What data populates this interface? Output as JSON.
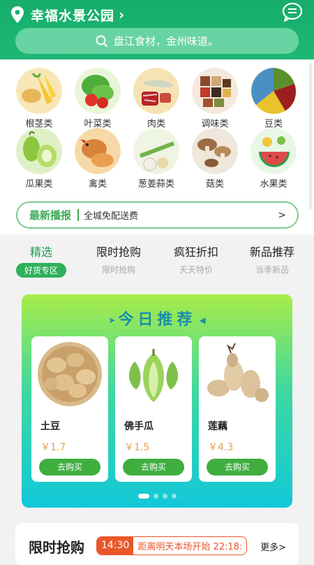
{
  "header": {
    "location": "幸福水景公园",
    "search_placeholder": "盘江食材，金州味道。"
  },
  "categories": [
    {
      "label": "根茎类",
      "icon": "root-vegetables-icon",
      "color": "#f4c24c"
    },
    {
      "label": "叶菜类",
      "icon": "leafy-greens-icon",
      "color": "#4fae3a"
    },
    {
      "label": "肉类",
      "icon": "meat-icon",
      "color": "#c8453a"
    },
    {
      "label": "调味类",
      "icon": "seasoning-icon",
      "color": "#a0522d"
    },
    {
      "label": "豆类",
      "icon": "beans-icon",
      "color": "#7a9a3a"
    },
    {
      "label": "瓜果类",
      "icon": "gourd-icon",
      "color": "#8cc63e"
    },
    {
      "label": "禽类",
      "icon": "poultry-icon",
      "color": "#d9823a"
    },
    {
      "label": "葱姜蒜类",
      "icon": "scallion-garlic-icon",
      "color": "#6fb447"
    },
    {
      "label": "菇类",
      "icon": "mushroom-icon",
      "color": "#b88a5a"
    },
    {
      "label": "水果类",
      "icon": "fruit-icon",
      "color": "#e04a4a"
    }
  ],
  "news": {
    "tag": "最新播报",
    "text": "全城免配送费",
    "arrow": ">"
  },
  "tabs": [
    {
      "title": "精选",
      "subtitle": "好货专区",
      "active": true
    },
    {
      "title": "限时抢购",
      "subtitle": "限时抢购",
      "active": false
    },
    {
      "title": "疯狂折扣",
      "subtitle": "天天特价",
      "active": false
    },
    {
      "title": "新品推荐",
      "subtitle": "当季新品",
      "active": false
    }
  ],
  "recommend": {
    "title": "今日推荐",
    "left_mark": "➤",
    "right_mark": "◀",
    "products": [
      {
        "name": "土豆",
        "price": "￥1.7",
        "button": "去购买",
        "icon": "potato-icon"
      },
      {
        "name": "佛手瓜",
        "price": "￥1.5",
        "button": "去购买",
        "icon": "chayote-icon"
      },
      {
        "name": "莲藕",
        "price": "￥4.3",
        "button": "去购买",
        "icon": "lotus-root-icon"
      }
    ],
    "pages": 4,
    "active_page": 0
  },
  "flash_sale": {
    "title": "限时抢购",
    "time": "14:30",
    "info": "距离明天本场开始 22:18:",
    "more": "更多>"
  }
}
